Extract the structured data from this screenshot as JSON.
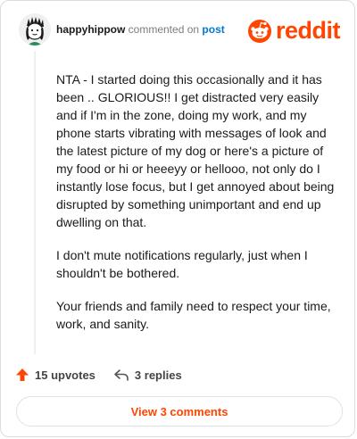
{
  "header": {
    "username": "happyhippow",
    "action_text": "commented on",
    "post_link": "post",
    "brand_name": "reddit"
  },
  "comment": {
    "paragraphs": [
      "NTA - I started doing this occasionally and it has been .. GLORIOUS!! I get distracted very easily and if I'm in the zone, doing my work, and my phone starts vibrating with messages of look and the latest picture of my dog or here's a picture of my food or hi or heeeyy or hellooo, not only do I instantly lose focus, but I get annoyed about being disrupted by something unimportant and end up dwelling on that.",
      "I don't mute notifications regularly, just when I shouldn't be bothered.",
      "Your friends and family need to respect your time, work, and sanity."
    ]
  },
  "actions": {
    "upvotes": "15 upvotes",
    "replies": "3 replies"
  },
  "footer": {
    "view_comments": "View 3 comments"
  },
  "colors": {
    "brand": "#ff4500",
    "link": "#0079d3",
    "text": "#1a1a1b"
  },
  "icons": {
    "avatar": "user-avatar",
    "brand": "reddit-snoo-icon",
    "upvote": "upvote-arrow-icon",
    "reply": "reply-arrow-icon"
  }
}
